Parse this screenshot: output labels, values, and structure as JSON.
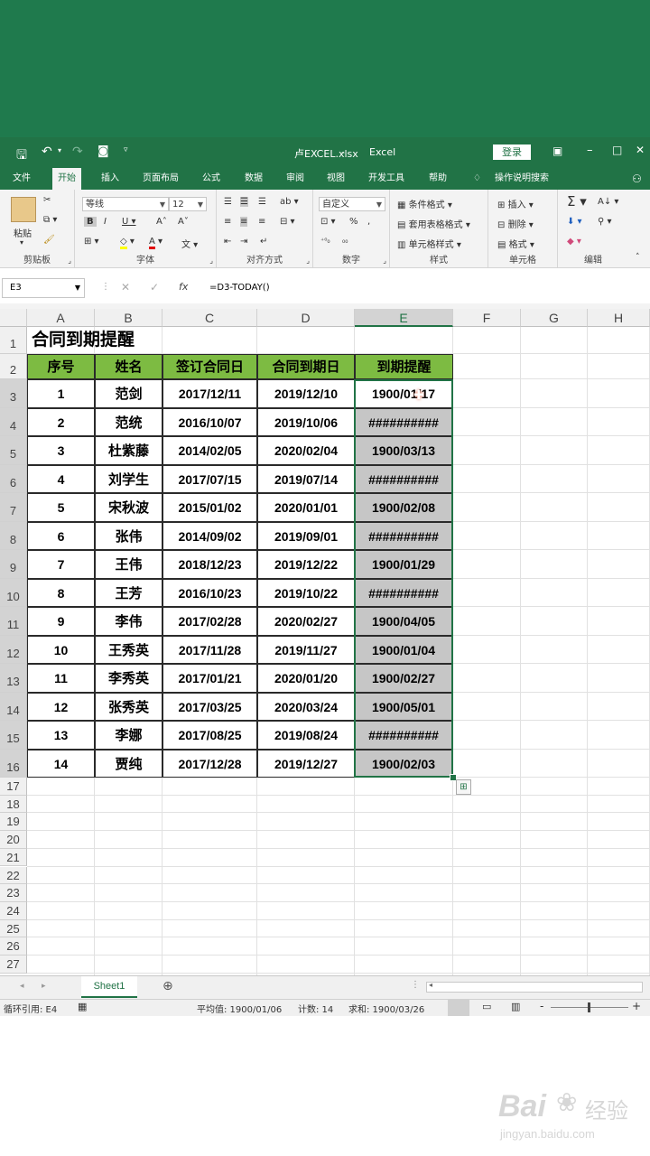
{
  "titlebar": {
    "filename": "卢EXCEL.xlsx",
    "app": "Excel",
    "login": "登录"
  },
  "ribbon_tabs": [
    "文件",
    "开始",
    "插入",
    "页面布局",
    "公式",
    "数据",
    "审阅",
    "视图",
    "开发工具",
    "帮助",
    "操作说明搜索"
  ],
  "ribbon": {
    "clipboard": {
      "paste": "粘贴",
      "label": "剪贴板"
    },
    "font": {
      "name": "等线",
      "size": "12",
      "label": "字体"
    },
    "alignment": {
      "label": "对齐方式"
    },
    "number": {
      "format": "自定义",
      "label": "数字"
    },
    "styles": {
      "conditional": "条件格式",
      "table": "套用表格格式",
      "cell": "单元格样式",
      "label": "样式"
    },
    "cells": {
      "insert": "插入",
      "delete": "删除",
      "format": "格式",
      "label": "单元格"
    },
    "editing": {
      "label": "编辑"
    }
  },
  "formula_bar": {
    "name_box": "E3",
    "formula": "=D3-TODAY()"
  },
  "columns": [
    "A",
    "B",
    "C",
    "D",
    "E",
    "F",
    "G",
    "H"
  ],
  "sheet": {
    "title": "合同到期提醒",
    "headers": [
      "序号",
      "姓名",
      "签订合同日",
      "合同到期日",
      "到期提醒"
    ],
    "rows": [
      [
        "1",
        "范剑",
        "2017/12/11",
        "2019/12/10",
        "1900/01/17"
      ],
      [
        "2",
        "范统",
        "2016/10/07",
        "2019/10/06",
        "##########"
      ],
      [
        "3",
        "杜紫藤",
        "2014/02/05",
        "2020/02/04",
        "1900/03/13"
      ],
      [
        "4",
        "刘学生",
        "2017/07/15",
        "2019/07/14",
        "##########"
      ],
      [
        "5",
        "宋秋波",
        "2015/01/02",
        "2020/01/01",
        "1900/02/08"
      ],
      [
        "6",
        "张伟",
        "2014/09/02",
        "2019/09/01",
        "##########"
      ],
      [
        "7",
        "王伟",
        "2018/12/23",
        "2019/12/22",
        "1900/01/29"
      ],
      [
        "8",
        "王芳",
        "2016/10/23",
        "2019/10/22",
        "##########"
      ],
      [
        "9",
        "李伟",
        "2017/02/28",
        "2020/02/27",
        "1900/04/05"
      ],
      [
        "10",
        "王秀英",
        "2017/11/28",
        "2019/11/27",
        "1900/01/04"
      ],
      [
        "11",
        "李秀英",
        "2017/01/21",
        "2020/01/20",
        "1900/02/27"
      ],
      [
        "12",
        "张秀英",
        "2017/03/25",
        "2020/03/24",
        "1900/05/01"
      ],
      [
        "13",
        "李娜",
        "2017/08/25",
        "2019/08/24",
        "##########"
      ],
      [
        "14",
        "贾纯",
        "2017/12/28",
        "2019/12/27",
        "1900/02/03"
      ]
    ]
  },
  "sheet_tab": "Sheet1",
  "status": {
    "circular": "循环引用: E4",
    "average": "平均值: 1900/01/06",
    "count": "计数: 14",
    "sum": "求和: 1900/03/26"
  },
  "watermark": {
    "brand": "Bai",
    "brand2": "经验",
    "url": "jingyan.baidu.com"
  },
  "colors": {
    "excel_green": "#217346",
    "header_fill": "#7dbb42",
    "selection_fill": "#c6c6c6"
  }
}
